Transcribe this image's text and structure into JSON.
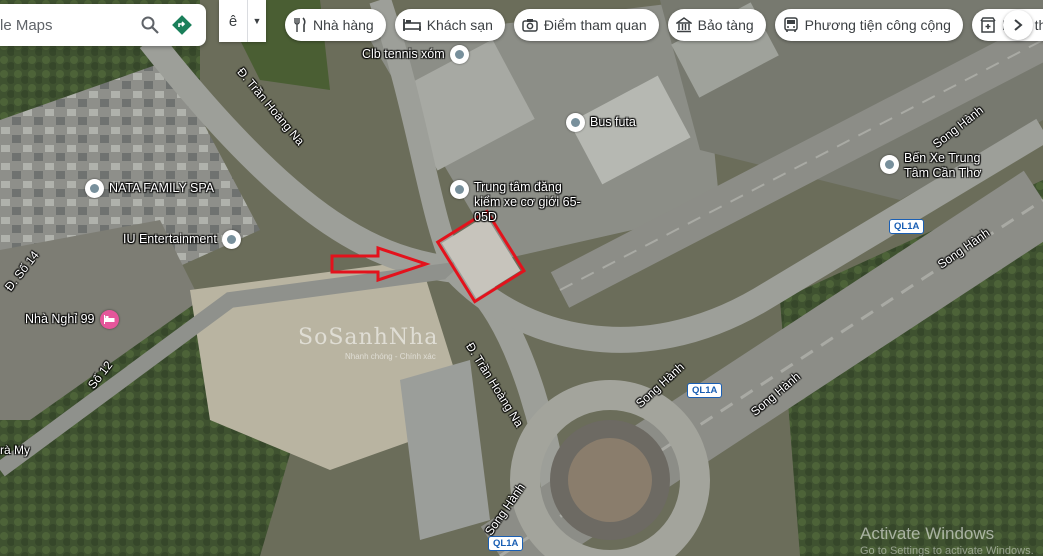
{
  "search": {
    "text": "le Maps"
  },
  "language_button": {
    "label": "ê"
  },
  "chips": [
    {
      "icon": "fork-knife-icon",
      "label": "Nhà hàng"
    },
    {
      "icon": "bed-icon",
      "label": "Khách sạn"
    },
    {
      "icon": "camera-icon",
      "label": "Điểm tham quan"
    },
    {
      "icon": "museum-icon",
      "label": "Bảo tàng"
    },
    {
      "icon": "bus-icon",
      "label": "Phương tiện công cộng"
    },
    {
      "icon": "pharmacy-icon",
      "label": "Hiệu thuốc"
    }
  ],
  "places": [
    {
      "name": "Clb tennis xóm"
    },
    {
      "name": "Bus futa"
    },
    {
      "name": "Bến Xe Trung Tâm Cần Thơ"
    },
    {
      "name": "NATA FAMILY SPA"
    },
    {
      "name": "IU Entertainment"
    },
    {
      "name": "Trung tâm đăng kiểm xe cơ giới 65-05D"
    },
    {
      "name": "Nhà Nghỉ 99"
    }
  ],
  "roads": {
    "tran_hoang_na_top": "Đ. Trần Hoàng Na",
    "tran_hoang_na_mid": "Đ. Trần Hoàng Na",
    "so_14": "Đ. Số 14",
    "so_12": "Số 12",
    "ra_my": "rà My",
    "song_hanh_1": "Song Hành",
    "song_hanh_2": "Song Hành",
    "song_hanh_3": "Song Hành",
    "song_hanh_4": "Song Hành",
    "song_hanh_5": "Song Hành"
  },
  "highways": {
    "ql1a_1": "QL1A",
    "ql1a_2": "QL1A",
    "ql1a_3": "QL1A"
  },
  "watermark": {
    "brand": "SoSanhNha",
    "sub": "Nhanh chóng - Chính xác"
  },
  "overlay": {
    "activate_title": "Activate Windows",
    "activate_sub": "Go to Settings to activate Windows."
  },
  "colors": {
    "highlight": "#e3121c",
    "arrow": "#e3121c",
    "pin_bg": "#ffffff",
    "accent_icon": "#1a7f5a"
  }
}
